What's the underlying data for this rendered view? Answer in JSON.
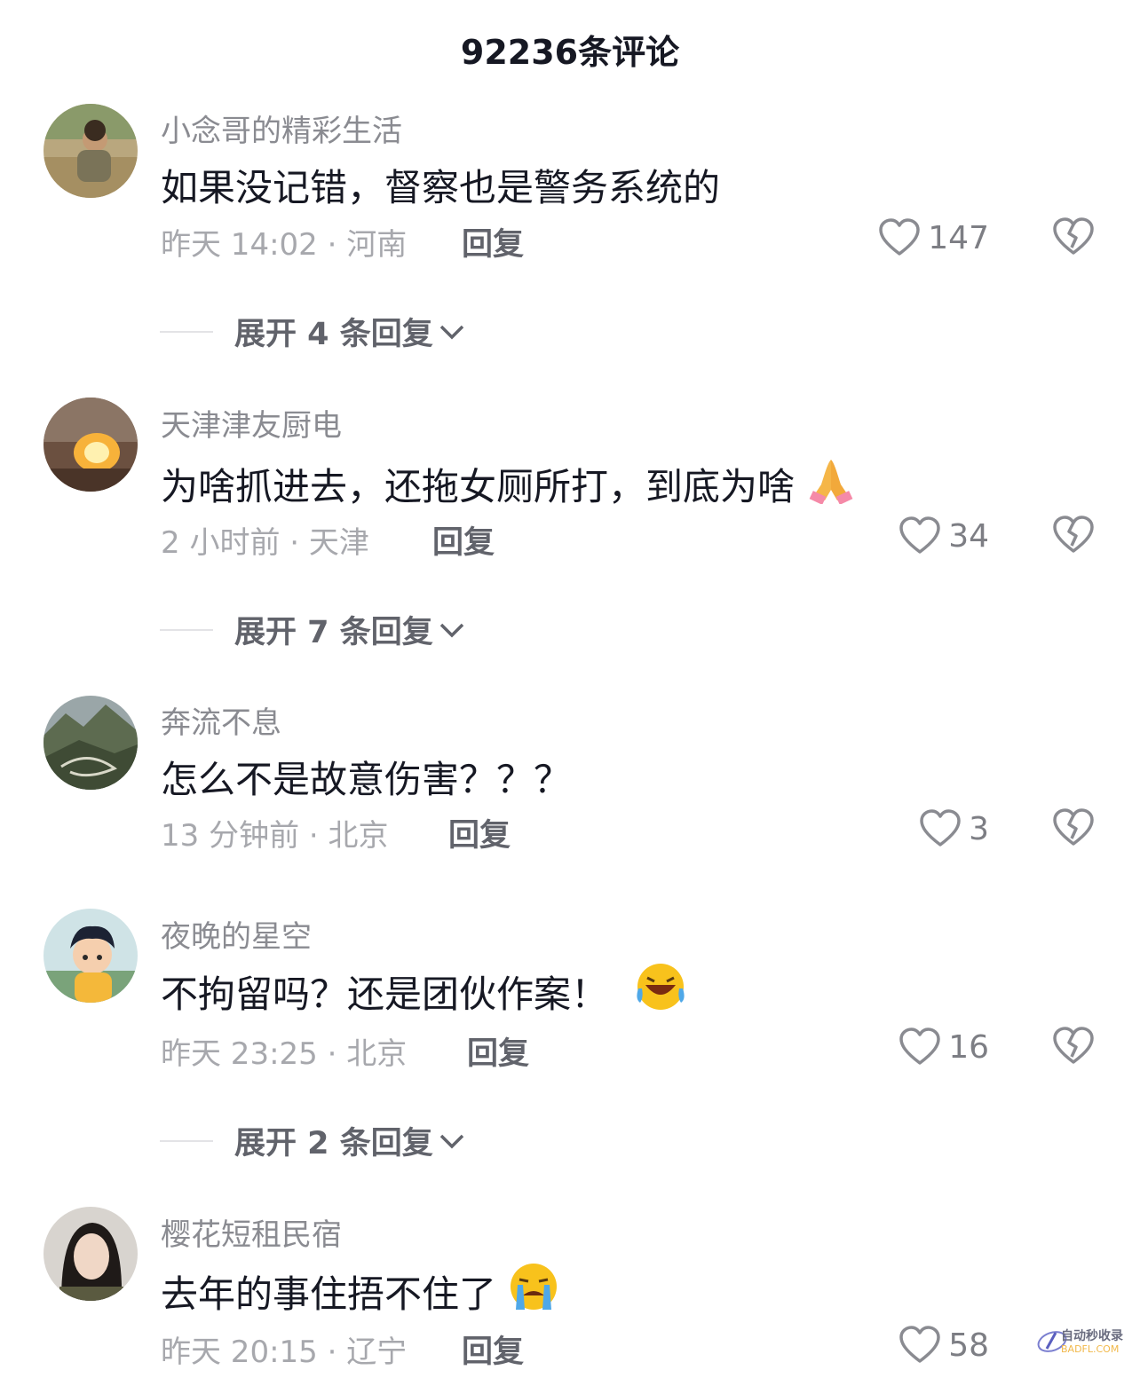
{
  "header": {
    "title": "92236条评论"
  },
  "comments": [
    {
      "username": "小念哥的精彩生活",
      "text": "如果没记错，督察也是警务系统的",
      "time_location": "昨天 14:02 · 河南",
      "reply_label": "回复",
      "likes": "147",
      "expand_label": "展开 4 条回复"
    },
    {
      "username": "天津津友厨电",
      "text": "为啥抓进去，还拖女厕所打，到底为啥",
      "emoji": "🙏",
      "time_location": "2 小时前 · 天津",
      "reply_label": "回复",
      "likes": "34",
      "expand_label": "展开 7 条回复"
    },
    {
      "username": "奔流不息",
      "text": "怎么不是故意伤害？？？",
      "time_location": "13 分钟前 · 北京",
      "reply_label": "回复",
      "likes": "3"
    },
    {
      "username": "夜晚的星空",
      "text": "不拘留吗？还是团伙作案！",
      "emoji": "laughing-crying-emoji",
      "time_location": "昨天 23:25 · 北京",
      "reply_label": "回复",
      "likes": "16",
      "expand_label": "展开 2 条回复"
    },
    {
      "username": "樱花短租民宿",
      "text": "去年的事住捂不住了",
      "emoji": "crying-emoji",
      "time_location": "昨天 20:15 · 辽宁",
      "reply_label": "回复",
      "likes": "58"
    }
  ],
  "watermark": {
    "line1": "自动秒收录",
    "line2": "BADFL.COM"
  },
  "colors": {
    "text": "#161823",
    "meta": "#a7a8ad",
    "username": "#8a8b91",
    "accent": "#61636b"
  }
}
